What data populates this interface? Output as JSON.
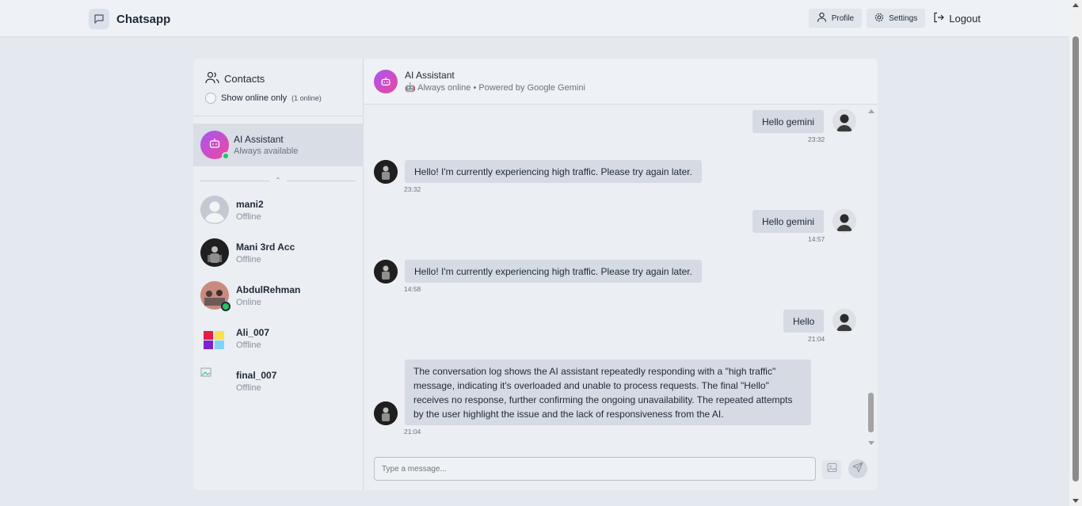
{
  "app": {
    "name": "Chatsapp"
  },
  "nav": {
    "profile": "Profile",
    "settings": "Settings",
    "logout": "Logout"
  },
  "sidebar": {
    "title": "Contacts",
    "online_toggle": "Show online only",
    "online_count": "(1 online)",
    "ai": {
      "name": "AI Assistant",
      "status": "Always available"
    },
    "contacts": [
      {
        "name": "mani2",
        "status": "Offline"
      },
      {
        "name": "Mani 3rd Acc",
        "status": "Offline"
      },
      {
        "name": "AbdulRehman",
        "status": "Online"
      },
      {
        "name": "Ali_007",
        "status": "Offline"
      },
      {
        "name": "final_007",
        "status": "Offline"
      }
    ]
  },
  "chat": {
    "name": "AI Assistant",
    "subtitle": "Always online • Powered by Google Gemini",
    "messages": [
      {
        "from": "user",
        "text": "Hello gemini",
        "time": "23:32"
      },
      {
        "from": "ai",
        "text": "Hello! I'm currently experiencing high traffic. Please try again later.",
        "time": "23:32"
      },
      {
        "from": "user",
        "text": "Hello gemini",
        "time": "14:57"
      },
      {
        "from": "ai",
        "text": "Hello! I'm currently experiencing high traffic. Please try again later.",
        "time": "14:58"
      },
      {
        "from": "user",
        "text": "Hello",
        "time": "21:04"
      },
      {
        "from": "ai",
        "text": "The conversation log shows the AI assistant repeatedly responding with a \"high traffic\" message, indicating it's overloaded and unable to process requests. The final \"Hello\" receives no response, further confirming the ongoing unavailability. The repeated attempts by the user highlight the issue and the lack of responsiveness from the AI.",
        "time": "21:04"
      }
    ],
    "composer_placeholder": "Type a message..."
  },
  "colors": {
    "accent_from": "#a855f7",
    "accent_to": "#ec4899",
    "online": "#22c55e"
  }
}
